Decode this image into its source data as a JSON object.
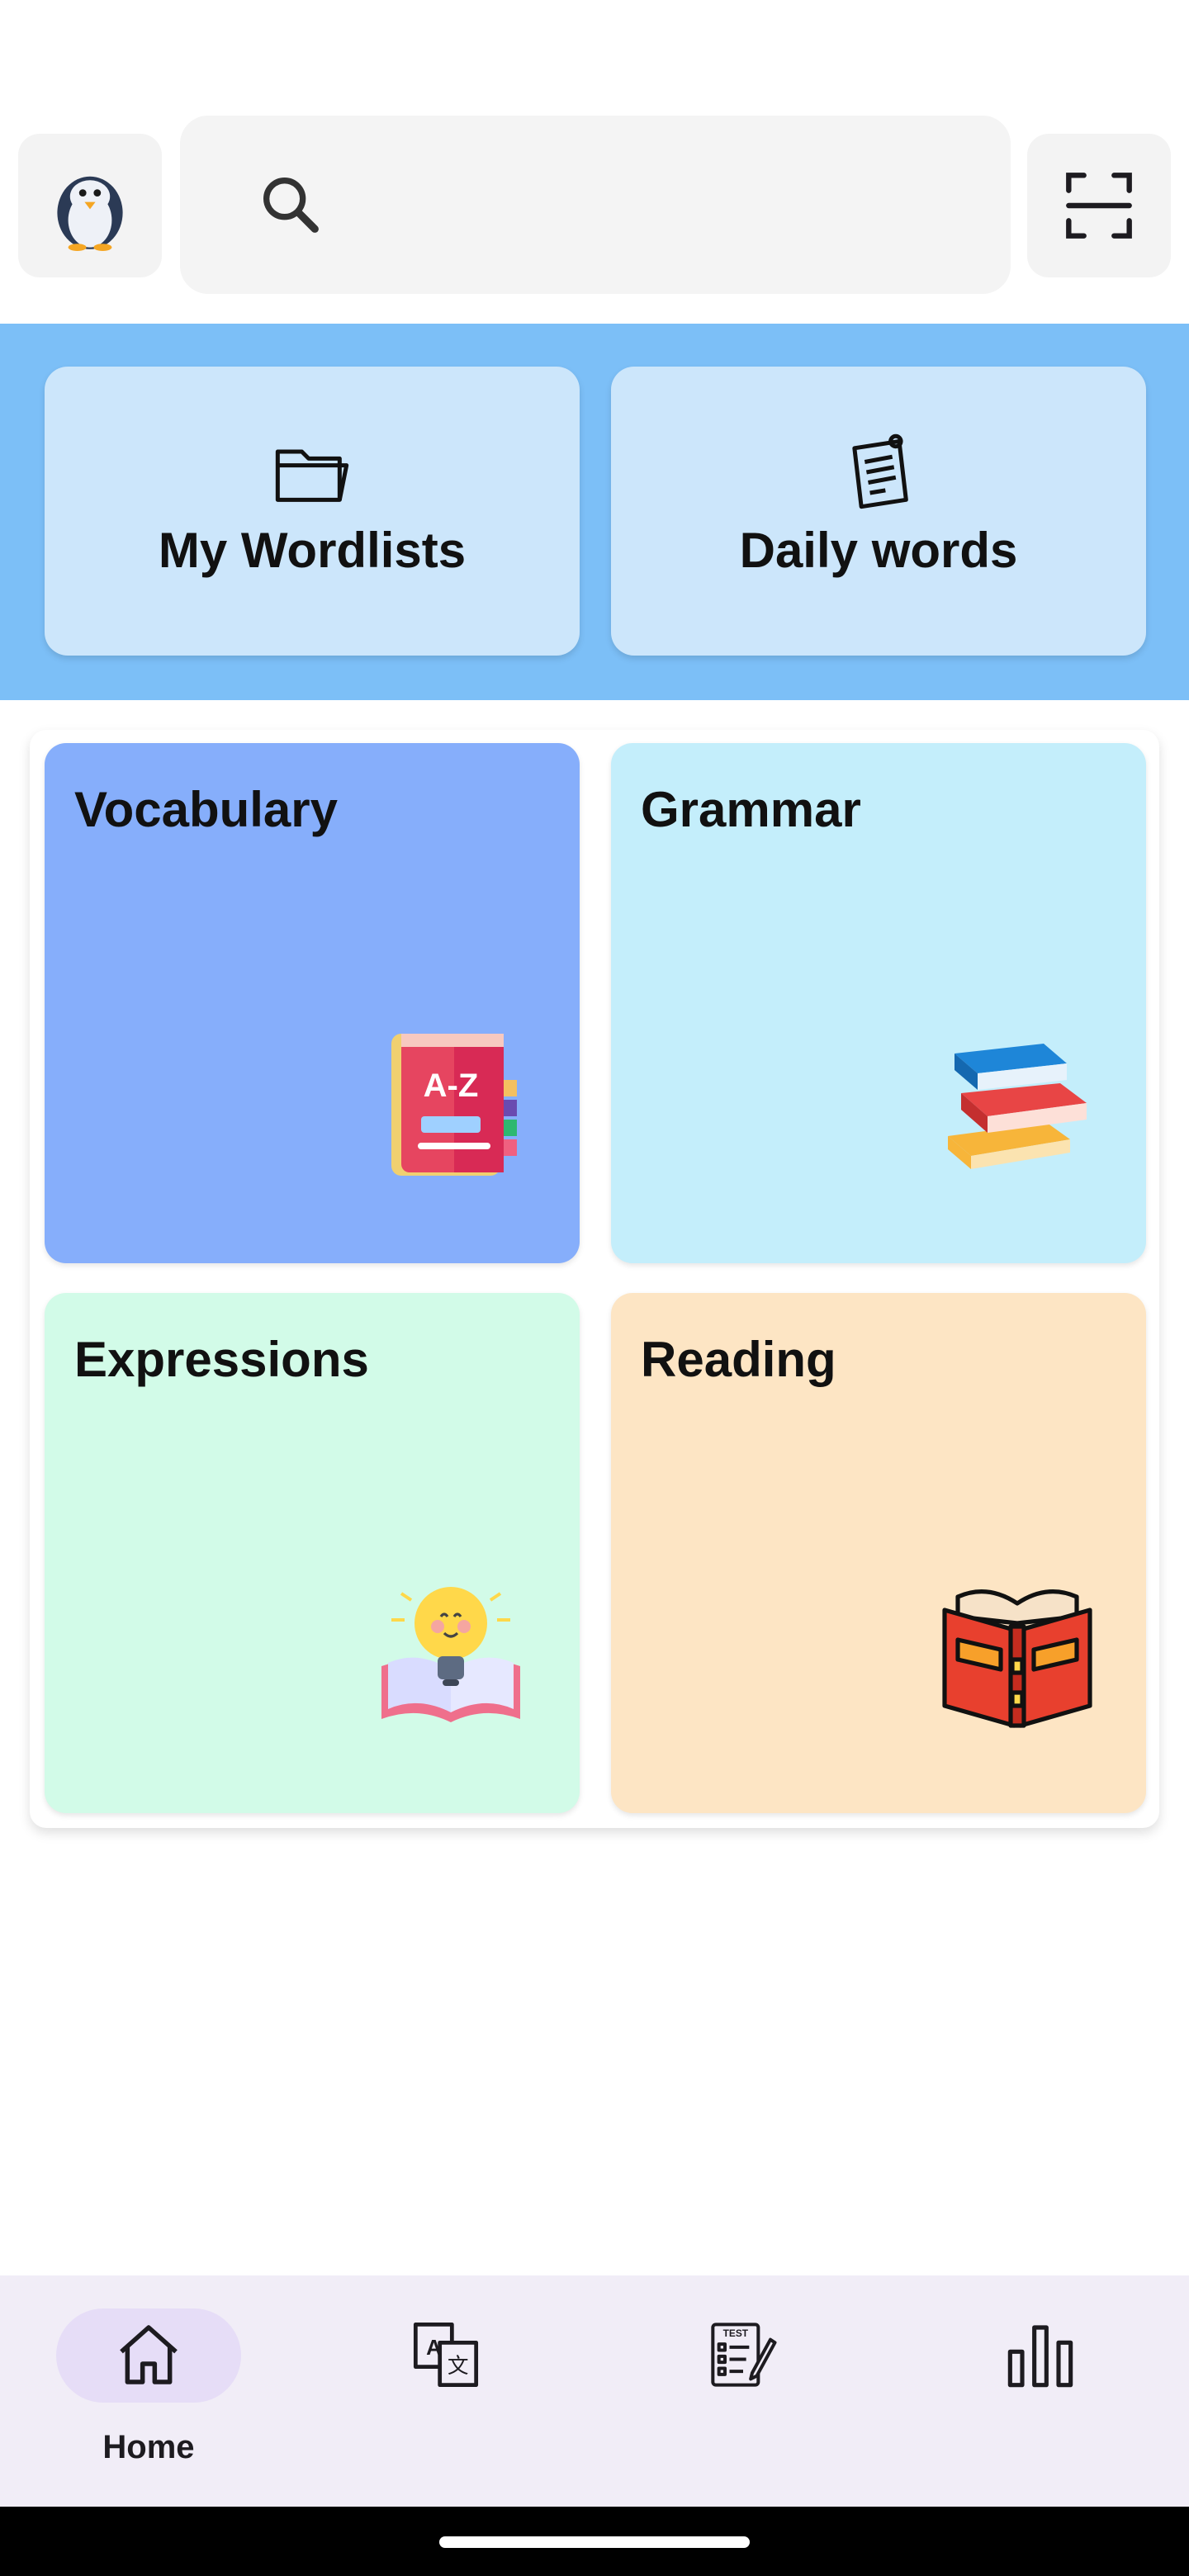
{
  "header": {
    "avatar_icon": "penguin-icon",
    "search": {
      "value": "",
      "placeholder": "",
      "icon": "search-icon"
    },
    "scan_icon": "scan-icon"
  },
  "quick_actions": [
    {
      "label": "My Wordlists",
      "icon": "folder-icon"
    },
    {
      "label": "Daily words",
      "icon": "note-icon"
    }
  ],
  "categories": [
    {
      "title": "Vocabulary",
      "icon": "az-book-icon",
      "color": "#86aefb"
    },
    {
      "title": "Grammar",
      "icon": "book-stack-icon",
      "color": "#c4eefb"
    },
    {
      "title": "Expressions",
      "icon": "lightbulb-book-icon",
      "color": "#d2fbe8"
    },
    {
      "title": "Reading",
      "icon": "open-book-icon",
      "color": "#fde5c4"
    }
  ],
  "bottom_nav": {
    "active": "Home",
    "items": [
      {
        "label": "Home",
        "icon": "home-icon"
      },
      {
        "label": "",
        "icon": "translate-icon"
      },
      {
        "label": "",
        "icon": "test-icon"
      },
      {
        "label": "",
        "icon": "stats-icon"
      }
    ]
  }
}
